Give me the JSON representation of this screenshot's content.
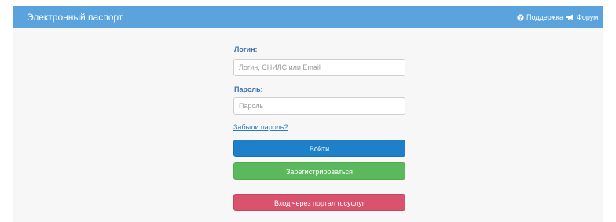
{
  "navbar": {
    "brand": "Электронный паспорт",
    "links": [
      {
        "label": "Поддержка",
        "icon": "question-circle-icon"
      },
      {
        "label": "Форум",
        "icon": "bullhorn-icon"
      }
    ]
  },
  "form": {
    "login": {
      "label": "Логин:",
      "placeholder": "Логин, СНИЛС или Email",
      "value": ""
    },
    "password": {
      "label": "Пароль:",
      "placeholder": "Пароль",
      "value": ""
    },
    "forgot_link": "Забыли пароль?"
  },
  "buttons": {
    "login": "Войти",
    "register": "Зарегистрироваться",
    "gosuslugi": "Вход через портал госуслуг"
  },
  "colors": {
    "navbar": "#5aa3dc",
    "login_button": "#1d80c8",
    "register_button": "#5cb85c",
    "gosuslugi_button": "#d9536f",
    "label_text": "#3a6fb3"
  }
}
